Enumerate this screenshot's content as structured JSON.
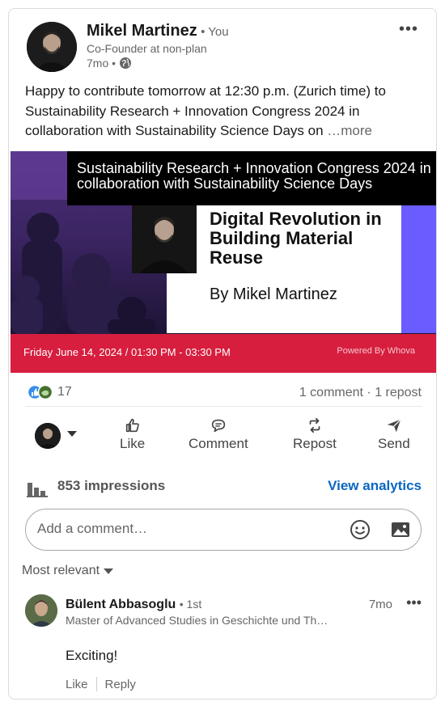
{
  "post": {
    "author_name": "Mikel Martinez",
    "author_you": "• You",
    "author_title": "Co-Founder at non-plan",
    "time": "7mo •",
    "overflow": "•••",
    "text": "Happy to contribute tomorrow at 12:30 p.m. (Zurich time) to Sustainability Research + Innovation Congress 2024 in collaboration with Sustainability Science Days on",
    "more": "…more"
  },
  "banner": {
    "top_text": "Sustainability Research + Innovation Congress 2024 in collaboration with Sustainability Science Days",
    "headline": "Digital Revolution in Building Material Reuse",
    "by": "By Mikel Martinez",
    "date": "Friday June 14, 2024 / 01:30 PM - 03:30 PM",
    "powered": "Powered By Whova"
  },
  "social": {
    "reactions_count": "17",
    "comments_reposts": "1 comment · 1 repost"
  },
  "actions": {
    "like": "Like",
    "comment": "Comment",
    "repost": "Repost",
    "send": "Send"
  },
  "impressions": {
    "text": "853 impressions",
    "view_analytics": "View analytics"
  },
  "comment_box": {
    "placeholder": "Add a comment…"
  },
  "sort": {
    "label": "Most relevant"
  },
  "comment": {
    "name": "Bülent Abbasoglu",
    "degree": "• 1st",
    "headline": "Master of Advanced Studies in Geschichte und Th…",
    "time": "7mo",
    "more": "•••",
    "body": "Exciting!",
    "like": "Like",
    "reply": "Reply"
  },
  "colors": {
    "link": "#0a66c2",
    "banner_red": "#d71e3e",
    "banner_purple": "#6a5cff"
  },
  "icons": [
    "globe-icon",
    "like-reaction-icon",
    "support-reaction-icon",
    "like-icon",
    "comment-icon",
    "repost-icon",
    "send-icon",
    "bar-chart-icon",
    "emoji-icon",
    "photo-icon"
  ]
}
